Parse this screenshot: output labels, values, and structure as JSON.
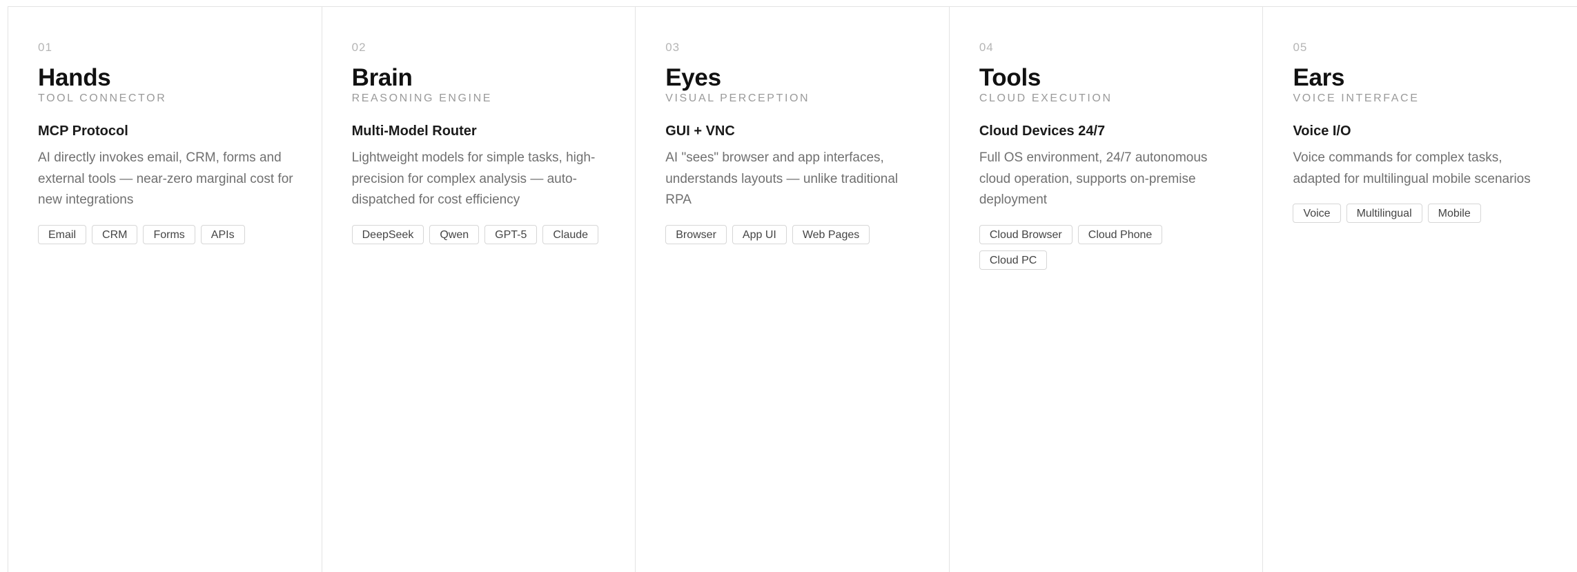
{
  "cards": [
    {
      "number": "01",
      "title": "Hands",
      "subtitle": "TOOL CONNECTOR",
      "feature": "MCP Protocol",
      "description": "AI directly invokes email, CRM, forms and external tools — near-zero marginal cost for new integrations",
      "tags": [
        "Email",
        "CRM",
        "Forms",
        "APIs"
      ]
    },
    {
      "number": "02",
      "title": "Brain",
      "subtitle": "REASONING ENGINE",
      "feature": "Multi-Model Router",
      "description": "Lightweight models for simple tasks, high-precision for complex analysis — auto-dispatched for cost efficiency",
      "tags": [
        "DeepSeek",
        "Qwen",
        "GPT-5",
        "Claude"
      ]
    },
    {
      "number": "03",
      "title": "Eyes",
      "subtitle": "VISUAL PERCEPTION",
      "feature": "GUI + VNC",
      "description": "AI \"sees\" browser and app interfaces, understands layouts — unlike traditional RPA",
      "tags": [
        "Browser",
        "App UI",
        "Web Pages"
      ]
    },
    {
      "number": "04",
      "title": "Tools",
      "subtitle": "CLOUD EXECUTION",
      "feature": "Cloud Devices 24/7",
      "description": "Full OS environment, 24/7 autonomous cloud operation, supports on-premise deployment",
      "tags": [
        "Cloud Browser",
        "Cloud Phone",
        "Cloud PC"
      ]
    },
    {
      "number": "05",
      "title": "Ears",
      "subtitle": "VOICE INTERFACE",
      "feature": "Voice I/O",
      "description": "Voice commands for complex tasks, adapted for multilingual mobile scenarios",
      "tags": [
        "Voice",
        "Multilingual",
        "Mobile"
      ]
    }
  ]
}
